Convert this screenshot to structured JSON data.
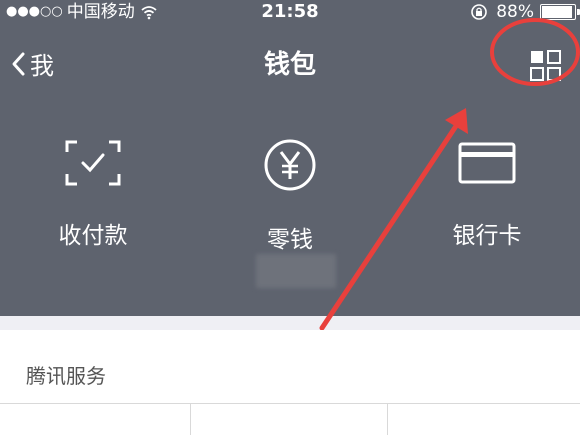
{
  "status_bar": {
    "signal": "●●●○○",
    "carrier": "中国移动",
    "time": "21:58",
    "battery": "88%",
    "battery_level": 0.88
  },
  "nav": {
    "back_label": "我",
    "title": "钱包"
  },
  "actions": [
    {
      "label": "收付款",
      "icon": "scan-pay-icon"
    },
    {
      "label": "零钱",
      "icon": "yuan-coin-icon"
    },
    {
      "label": "银行卡",
      "icon": "bank-card-icon"
    }
  ],
  "services": {
    "title": "腾讯服务"
  },
  "colors": {
    "header_bg": "#5e636e",
    "annotation_red": "#e8403c"
  }
}
